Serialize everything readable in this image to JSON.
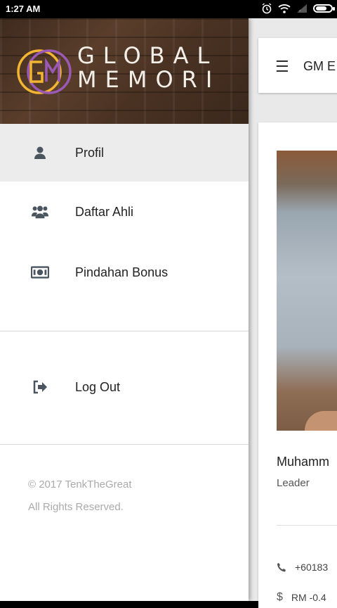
{
  "status_bar": {
    "time": "1:27 AM",
    "battery_level": 0.75
  },
  "drawer": {
    "logo_initials": "GM",
    "logo_line1": "GLOBAL",
    "logo_line2": "MEMORI",
    "menu_items": [
      {
        "label": "Profil",
        "icon": "user-icon",
        "active": true
      },
      {
        "label": "Daftar Ahli",
        "icon": "users-group-icon",
        "active": false
      },
      {
        "label": "Pindahan Bonus",
        "icon": "money-bill-icon",
        "active": false
      }
    ],
    "logout_label": "Log Out",
    "footer_copyright": "© 2017 TenkTheGreat",
    "footer_rights": "All Rights Reserved."
  },
  "app": {
    "title": "GM E",
    "member_name": "Muhamm",
    "member_role": "Leader",
    "phone": "+60183",
    "balance": "RM -0.4"
  },
  "colors": {
    "drawer_bg": "#ffffff",
    "active_item_bg": "#ececec",
    "icon_color": "#4a5560",
    "logo_ring_yellow": "#f2b632",
    "logo_ring_purple": "#9b59b6"
  }
}
